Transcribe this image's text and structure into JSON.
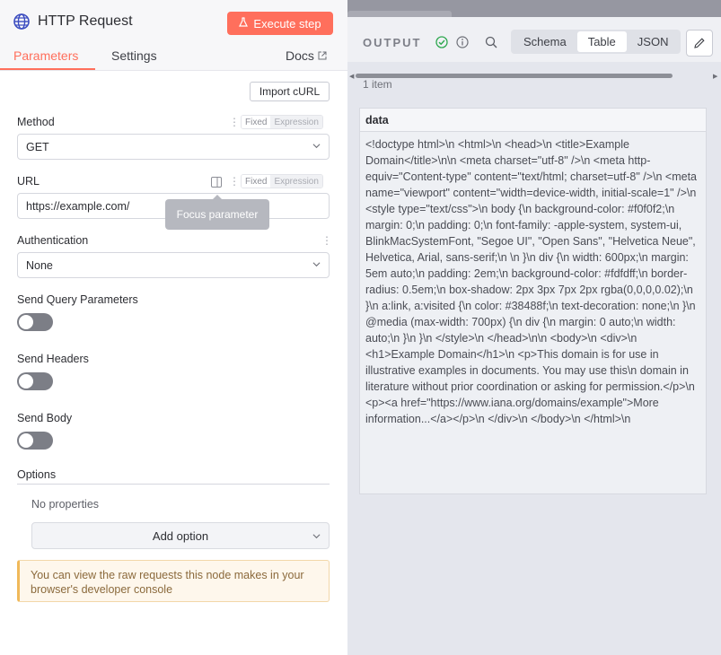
{
  "node": {
    "title": "HTTP Request",
    "execute_label": "Execute step"
  },
  "tabs": [
    {
      "label": "Parameters"
    },
    {
      "label": "Settings"
    }
  ],
  "docs_label": "Docs",
  "import_curl_label": "Import cURL",
  "fixed_label": "Fixed",
  "expression_label": "Expression",
  "method": {
    "label": "Method",
    "value": "GET"
  },
  "url": {
    "label": "URL",
    "value": "https://example.com/",
    "tooltip": "Focus parameter"
  },
  "authentication": {
    "label": "Authentication",
    "value": "None"
  },
  "send_query": {
    "label": "Send Query Parameters",
    "on": false
  },
  "send_headers": {
    "label": "Send Headers",
    "on": false
  },
  "send_body": {
    "label": "Send Body",
    "on": false
  },
  "options": {
    "label": "Options",
    "empty_text": "No properties",
    "add_label": "Add option"
  },
  "notice_text": "You can view the raw requests this node makes in your browser's developer console",
  "output": {
    "title": "OUTPUT",
    "views": [
      {
        "label": "Schema"
      },
      {
        "label": "Table"
      },
      {
        "label": "JSON"
      }
    ],
    "selected_view": "Table",
    "item_count": "1 item",
    "column_header": "data",
    "cell_value": "<!doctype html>\\n <html>\\n <head>\\n    <title>Example Domain</title>\\n\\n    <meta charset=\"utf-8\" />\\n    <meta http-equiv=\"Content-type\" content=\"text/html; charset=utf-8\" />\\n    <meta name=\"viewport\" content=\"width=device-width, initial-scale=1\" />\\n    <style type=\"text/css\">\\n    body {\\n        background-color: #f0f0f2;\\n        margin: 0;\\n        padding: 0;\\n        font-family: -apple-system, system-ui, BlinkMacSystemFont, \"Segoe UI\", \"Open Sans\", \"Helvetica Neue\", Helvetica, Arial, sans-serif;\\n        \\n    }\\n    div {\\n        width: 600px;\\n        margin: 5em auto;\\n        padding: 2em;\\n        background-color: #fdfdff;\\n        border-radius: 0.5em;\\n        box-shadow: 2px 3px 7px 2px rgba(0,0,0,0.02);\\n    }\\n    a:link, a:visited {\\n        color: #38488f;\\n        text-decoration: none;\\n    }\\n    @media (max-width: 700px) {\\n        div {\\n            margin: 0 auto;\\n            width: auto;\\n        }\\n    }\\n    </style>\\n </head>\\n\\n <body>\\n <div>\\n    <h1>Example Domain</h1>\\n    <p>This domain is for use in illustrative examples in documents. You may use this\\n    domain in literature without prior coordination or asking for permission.</p>\\n    <p><a href=\"https://www.iana.org/domains/example\">More information...</a></p>\\n </div>\\n </body>\\n </html>\\n"
  },
  "colors": {
    "accent": "#ff6f5c",
    "success": "#2ea84f"
  }
}
